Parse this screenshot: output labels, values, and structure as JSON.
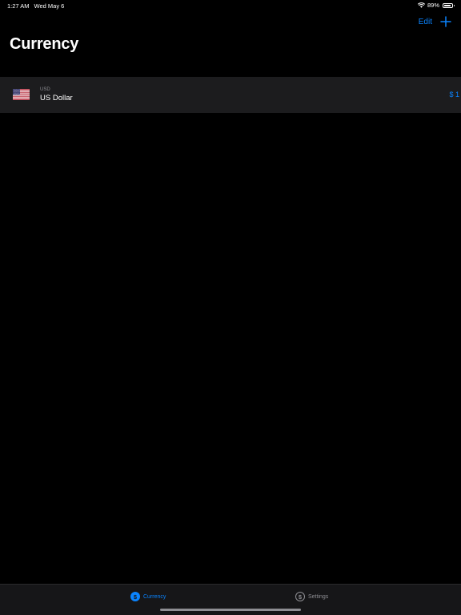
{
  "status_bar": {
    "time": "1:27 AM",
    "date": "Wed May 6",
    "battery_percent": "89%",
    "battery_level": 0.89,
    "wifi_icon": "wifi-icon",
    "battery_icon": "battery-icon"
  },
  "nav": {
    "edit_label": "Edit",
    "add_icon": "plus-icon",
    "title": "Currency"
  },
  "currencies": [
    {
      "code": "USD",
      "name": "US Dollar",
      "value": "$ 1",
      "flag_icon": "us-flag-icon"
    }
  ],
  "tab_bar": {
    "tabs": [
      {
        "label": "Currency",
        "icon": "dollar-circle-filled-icon",
        "selected": true
      },
      {
        "label": "Settings",
        "icon": "dollar-circle-outline-icon",
        "selected": false
      }
    ]
  },
  "colors": {
    "accent": "#0a84ff",
    "background": "#000000",
    "row_background": "#1c1c1e",
    "secondary_text": "#8e8e93"
  }
}
